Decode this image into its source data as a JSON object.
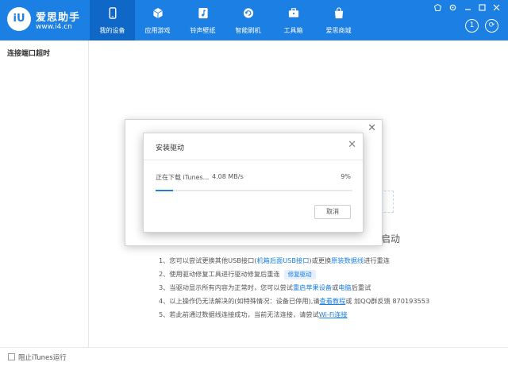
{
  "app": {
    "brand": "爱思助手",
    "url": "www.i4.cn",
    "logo_text": "iU"
  },
  "nav": [
    {
      "label": "我的设备",
      "icon": "phone-icon",
      "active": true
    },
    {
      "label": "应用游戏",
      "icon": "cube-icon",
      "active": false
    },
    {
      "label": "铃声壁纸",
      "icon": "music-note-icon",
      "active": false
    },
    {
      "label": "智能刷机",
      "icon": "refresh-gear-icon",
      "active": false
    },
    {
      "label": "工具箱",
      "icon": "toolbox-icon",
      "active": false
    },
    {
      "label": "爱思商城",
      "icon": "shopping-bag-icon",
      "active": false
    }
  ],
  "window_controls": {
    "help": "1",
    "refresh": "⟳"
  },
  "sidebar": {
    "title": "连接端口超时"
  },
  "instructions": {
    "line1": {
      "pre": "1、您可以尝试更换其他USB接口(",
      "link1": "机箱后面USB接口",
      "mid": ")或更换",
      "link2": "原装数据线",
      "post": "进行重连"
    },
    "line2": {
      "text": "2、使用驱动修复工具进行驱动修复后重连",
      "tag": "修复驱动"
    },
    "line3": {
      "pre": "3、当驱动显示所有内容为正常时，您可以尝试",
      "link1": "重启苹果设备",
      "mid": "或",
      "link2": "电脑",
      "post": "后重试"
    },
    "line4": {
      "pre": "4、以上操作仍无法解决的(如特殊情况：设备已停用),请",
      "link": "查看教程",
      "post": "或 加QQ群反馈 870193553"
    },
    "line5": {
      "pre": "5、若此前通过数据线连接成功，当前无法连接，请尝试",
      "link": "Wi-Fi连接"
    }
  },
  "behind_text": "启动",
  "dialog": {
    "title": "安装驱动",
    "status": "正在下载 iTunes...",
    "speed": "4.08 MB/s",
    "percent": "9%",
    "progress": 0.09,
    "cancel": "取消"
  },
  "footer": {
    "label": "阻止iTunes运行"
  },
  "colors": {
    "accent": "#1c7fe3",
    "nav_active": "#0f67c7"
  }
}
